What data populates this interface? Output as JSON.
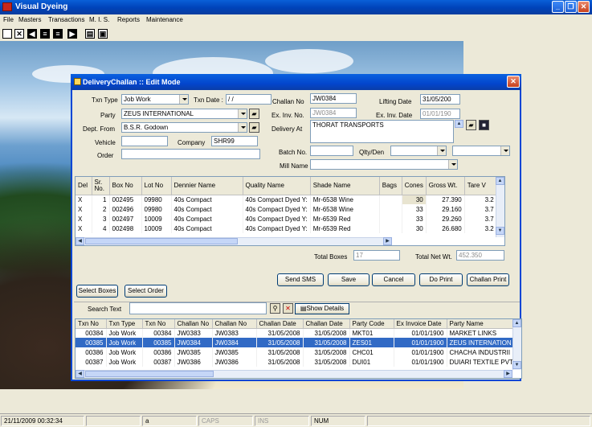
{
  "app": {
    "title": "Visual Dyeing"
  },
  "menu": [
    "File",
    "Masters",
    "Transactions",
    "M. I. S.",
    "Reports",
    "Maintenance"
  ],
  "dialog": {
    "title": "DeliveryChallan :: Edit Mode",
    "labels": {
      "txn_type": "Txn Type",
      "txn_date": "Txn Date :",
      "challan_no": "Challan No",
      "lifting_date": "Lifting Date",
      "party": "Party",
      "ex_inv_no": "Ex. Inv. No.",
      "ex_inv_date": "Ex. Inv. Date",
      "dept_from": "Dept. From",
      "delivery_at": "Delivery At",
      "vehicle": "Vehicle",
      "company": "Company",
      "order": "Order",
      "batch_no": "Batch No.",
      "qlty_den": "Qlty/Den",
      "mill_name": "Mill Name :",
      "total_boxes": "Total Boxes",
      "total_net_wt": "Total Net Wt."
    },
    "values": {
      "txn_type": "Job Work",
      "txn_date": "/  /",
      "challan_no": "JW0384",
      "lifting_date": "31/05/200",
      "party": "ZEUS INTERNATIONAL",
      "ex_inv_no": "JW0384",
      "ex_inv_date": "01/01/190",
      "dept_from": "B.S.R. Godown",
      "delivery_at": "THORAT TRANSPORTS",
      "vehicle": "",
      "company": "SHR99",
      "order": "",
      "batch_no": "",
      "qlty_den": "",
      "mill_name": "",
      "total_boxes": "17",
      "total_net_wt": "452.350"
    },
    "grid": {
      "columns": [
        "Del",
        "Sr. No.",
        "Box No",
        "Lot No",
        "Dennier Name",
        "Quality Name",
        "Shade Name",
        "Bags",
        "Cones",
        "Gross Wt.",
        "Tare V"
      ],
      "rows": [
        [
          "X",
          "1",
          "002495",
          "09980",
          "40s Compact",
          "40s Compact Dyed Y:",
          "Mr-6538 Wine",
          "",
          "30",
          "27.390",
          "3.2"
        ],
        [
          "X",
          "2",
          "002496",
          "09980",
          "40s Compact",
          "40s Compact Dyed Y:",
          "Mr-6538 Wine",
          "",
          "33",
          "29.160",
          "3.7"
        ],
        [
          "X",
          "3",
          "002497",
          "10009",
          "40s Compact",
          "40s Compact Dyed Y:",
          "Mr-6539 Red",
          "",
          "33",
          "29.260",
          "3.7"
        ],
        [
          "X",
          "4",
          "002498",
          "10009",
          "40s Compact",
          "40s Compact Dyed Y:",
          "Mr-6539 Red",
          "",
          "30",
          "26.680",
          "3.2"
        ]
      ]
    },
    "buttons": {
      "send_sms": "Send SMS",
      "save": "Save",
      "cancel": "Cancel",
      "do_print": "Do Print",
      "challan_print": "Challan Print",
      "select_boxes": "Select Boxes",
      "select_order": "Select Order"
    },
    "search": {
      "label": "Search Text",
      "value": "",
      "show_details": "Show Details"
    },
    "list": {
      "columns": [
        "Txn No",
        "Txn Type",
        "Txn No",
        "Challan No",
        "Challan No",
        "Challan Date",
        "Challan Date",
        "Party Code",
        "Ex Invoice Date",
        "Party Name"
      ],
      "rows": [
        [
          "00384",
          "Job Work",
          "00384",
          "JW0383",
          "JW0383",
          "31/05/2008",
          "31/05/2008",
          "MKT01",
          "01/01/1900",
          "MARKET LINKS"
        ],
        [
          "00385",
          "Job Work",
          "00385",
          "JW0384",
          "JW0384",
          "31/05/2008",
          "31/05/2008",
          "ZES01",
          "01/01/1900",
          "ZEUS INTERNATION"
        ],
        [
          "00386",
          "Job Work",
          "00386",
          "JW0385",
          "JW0385",
          "31/05/2008",
          "31/05/2008",
          "CHC01",
          "01/01/1900",
          "CHACHA INDUSTRII"
        ],
        [
          "00387",
          "Job Work",
          "00387",
          "JW0386",
          "JW0386",
          "31/05/2008",
          "31/05/2008",
          "DUI01",
          "01/01/1900",
          "DUIARI TEXTILE PVT"
        ]
      ],
      "selected_row": 1
    }
  },
  "status": {
    "datetime": "21/11/2009 00:32:34",
    "panel2": "",
    "panel3": "a",
    "caps": "CAPS",
    "ins": "INS",
    "num": "NUM"
  }
}
